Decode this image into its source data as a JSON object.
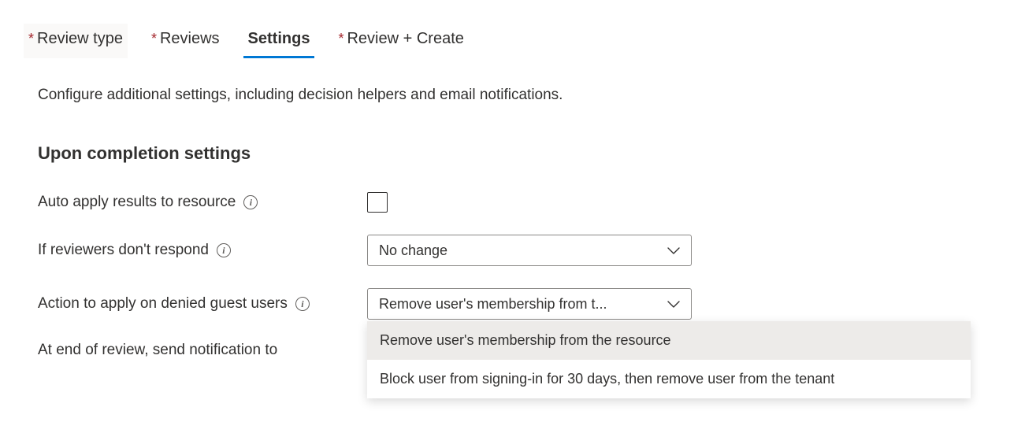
{
  "tabs": {
    "review_type": "Review type",
    "reviews": "Reviews",
    "settings": "Settings",
    "review_create": "Review + Create"
  },
  "description": "Configure additional settings, including decision helpers and email notifications.",
  "section_title": "Upon completion settings",
  "fields": {
    "auto_apply": "Auto apply results to resource",
    "no_respond": "If reviewers don't respond",
    "no_respond_value": "No change",
    "denied_action": "Action to apply on denied guest users",
    "denied_action_value": "Remove user's membership from t...",
    "end_notify": "At end of review, send notification to"
  },
  "dropdown_options": {
    "opt1": "Remove user's membership from the resource",
    "opt2": "Block user from signing-in for 30 days, then remove user from the tenant"
  }
}
